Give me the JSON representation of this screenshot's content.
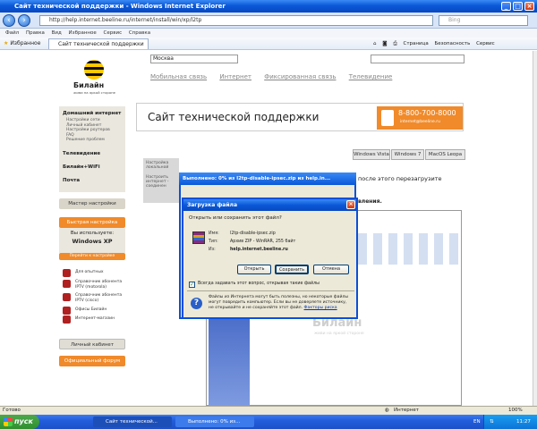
{
  "window": {
    "title": "Сайт технической поддержки - Windows Internet Explorer"
  },
  "browser": {
    "url": "http://help.internet.beeline.ru/internet/install/win/xp/l2tp",
    "search_placeholder": "Bing",
    "menu": [
      "Файл",
      "Правка",
      "Вид",
      "Избранное",
      "Сервис",
      "Справка"
    ],
    "favorites_label": "Избранное",
    "tab_label": "Сайт технической поддержки",
    "toolbar_page": "Страница",
    "toolbar_security": "Безопасность",
    "toolbar_tools": "Сервис"
  },
  "page": {
    "logo_text": "Билайн",
    "logo_sub": "живи на яркой стороне",
    "region": "Москва",
    "nav_links": [
      "Мобильная связь",
      "Интернет",
      "Фиксированная связь",
      "Телевидение"
    ],
    "sidebar": {
      "home_internet": "Домашний интернет",
      "sub_items": [
        "Настройки сети",
        "Личный кабинет",
        "Настройки роутеров",
        "FAQ",
        "Решение проблем"
      ],
      "tv": "Телевидение",
      "wifi": "Билайн+WiFi",
      "mail": "Почта",
      "wizard": "Мастер настройки",
      "quick": "Быстрая настройка",
      "os_question": "Вы используете:",
      "os_value": "Windows XP",
      "change_os": "Перейти к настройке",
      "links": [
        "Для опытных",
        "Справочник абонента IPTV (motorola)",
        "Справочник абонента IPTV (cisco)",
        "Офисы Билайн",
        "Интернет-магазин"
      ],
      "cabinet": "Личный кабинет",
      "forum": "Официальный форум"
    },
    "banner_title": "Сайт технической поддержки",
    "phone": "8-800-700-8000",
    "phone_email": "internet@beeline.ru",
    "os_tabs": [
      "Windows Vista",
      "Windows 7",
      "MacOS Leopa"
    ],
    "left_tab_lines": [
      "Настройка",
      "локальной",
      "Настроить",
      "интернет -",
      "соединен"
    ],
    "after_text": "после этого перезагрузите",
    "dots_text": "вления.",
    "watermark_text": "Билайн",
    "watermark_sub": "живи на яркой стороне"
  },
  "progress_window": {
    "title": "Выполнено: 0% из l2tp-disable-ipsec.zip из help.in..."
  },
  "dialog": {
    "title": "Загрузка файла",
    "question": "Открыть или сохранить этот файл?",
    "name_label": "Имя:",
    "name_value": "l2tp-disable-ipsec.zip",
    "type_label": "Тип:",
    "type_value": "Архив ZIP - WinRAR, 255 байт",
    "from_label": "Из:",
    "from_value": "help.internet.beeline.ru",
    "open_btn": "Открыть",
    "save_btn": "Сохранить",
    "cancel_btn": "Отмена",
    "always_ask": "Всегда задавать этот вопрос, открывая такие файлы",
    "warning": "Файлы из Интернета могут быть полезны, но некоторые файлы могут повредить компьютер. Если вы не доверяете источнику, не открывайте и не сохраняйте этот файл.",
    "warning_link": "Факторы риска"
  },
  "status": {
    "left": "Готово",
    "zone": "Интернет",
    "zoom": "100%"
  },
  "taskbar": {
    "start": "пуск",
    "items": [
      "Сайт технической...",
      "Выполнено: 0% из..."
    ],
    "lang": "EN",
    "clock": "11:27"
  }
}
